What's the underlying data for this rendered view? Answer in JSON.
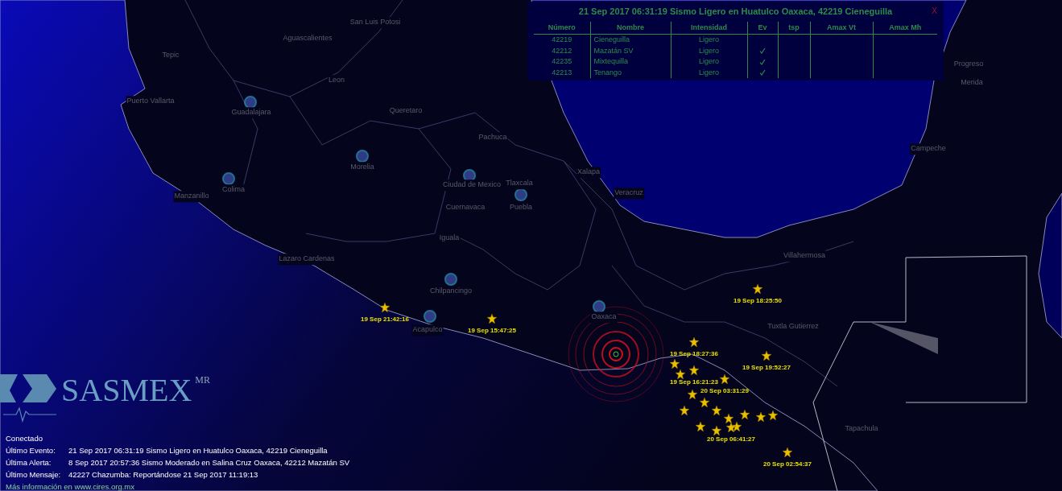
{
  "alert_panel": {
    "title": "21 Sep 2017 06:31:19 Sismo Ligero en Huatulco Oaxaca, 42219 Cieneguilla",
    "close": "X",
    "columns": [
      "Número",
      "Nombre",
      "Intensidad",
      "Ev",
      "tsp",
      "Amax Vt",
      "Amax Mh"
    ],
    "rows": [
      {
        "numero": "42219",
        "nombre": "Cieneguilla",
        "intensidad": "Ligero",
        "ev": false
      },
      {
        "numero": "42212",
        "nombre": "Mazatán SV",
        "intensidad": "Ligero",
        "ev": true
      },
      {
        "numero": "42235",
        "nombre": "Mixtequilla",
        "intensidad": "Ligero",
        "ev": true
      },
      {
        "numero": "42213",
        "nombre": "Tenango",
        "intensidad": "Ligero",
        "ev": true
      }
    ]
  },
  "map": {
    "cities": [
      "San Luis Potosi",
      "Aguascalientes",
      "Tepic",
      "Leon",
      "Puerto Vallarta",
      "Guadalajara",
      "Queretaro",
      "Pachuca",
      "Morelia",
      "Ciudad de Mexico",
      "Xalapa",
      "Tlaxcala",
      "Manzanillo",
      "Colima",
      "Puebla",
      "Veracruz",
      "Cuernavaca",
      "Iguala",
      "Lazaro Cardenas",
      "Chilpancingo",
      "Villahermosa",
      "Oaxaca",
      "Acapulco",
      "Tuxtla Gutierrez",
      "Progreso",
      "Merida",
      "Campeche",
      "Tapachula"
    ],
    "events": [
      "19 Sep 21:42:16",
      "19 Sep 15:47:25",
      "19 Sep 18:25:50",
      "19 Sep 19:52:27",
      "19 Sep 18:27:36",
      "19 Sep 16:21:23",
      "20 Sep 03:31:29",
      "20 Sep 06:41:27",
      "20 Sep 02:54:37"
    ]
  },
  "logo": {
    "name": "SASMEX",
    "mark": "MR"
  },
  "status": {
    "connection": "Conectado",
    "lines": [
      {
        "label": "Último Evento:",
        "value": "21 Sep 2017 06:31:19 Sismo Ligero en Huatulco Oaxaca, 42219 Cieneguilla"
      },
      {
        "label": "Última Alerta:",
        "value": "8 Sep 2017 20:57:36 Sismo Moderado en Salina Cruz Oaxaca, 42212 Mazatán SV"
      },
      {
        "label": "Último Mensaje:",
        "value": "42227 Chazumba: Reportándose 21 Sep 2017 11:19:13"
      }
    ],
    "info": "Más información en www.cires.org.mx"
  }
}
